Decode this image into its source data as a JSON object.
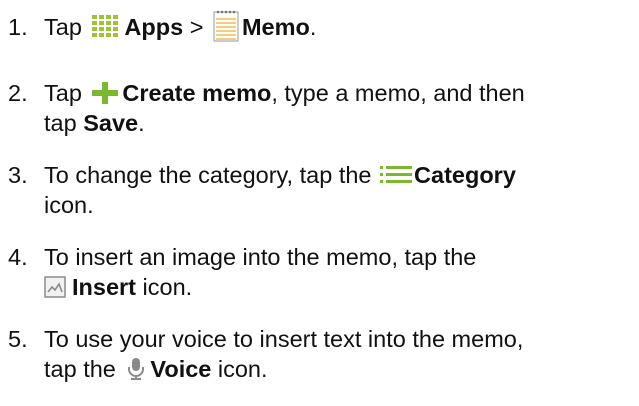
{
  "steps": [
    {
      "number": "1.",
      "tap": "Tap",
      "apps_label": "Apps",
      "separator": ">",
      "memo_label": "Memo",
      "end": ".",
      "icons": [
        "apps-grid-icon",
        "memo-notepad-icon"
      ]
    },
    {
      "number": "2.",
      "tap": "Tap",
      "create_label": "Create memo",
      "mid": ", type a memo, and then",
      "line2_start": "tap",
      "save_label": "Save",
      "end": ".",
      "icons": [
        "plus-icon"
      ]
    },
    {
      "number": "3.",
      "text": "To change the category, tap the",
      "category_label": "Category",
      "line2": "icon.",
      "icons": [
        "category-list-icon"
      ]
    },
    {
      "number": "4.",
      "text": "To insert an image into the memo, tap the",
      "insert_label": "Insert",
      "line2_end": "icon.",
      "icons": [
        "insert-image-icon"
      ]
    },
    {
      "number": "5.",
      "text": "To use your voice to insert text into the memo,",
      "line2_start": "tap the",
      "voice_label": "Voice",
      "line2_end": "icon.",
      "icons": [
        "microphone-icon"
      ]
    }
  ],
  "colors": {
    "text": "#111111",
    "apps_icon": "#9ec23a",
    "plus_icon": "#7cb82f",
    "category_icon": "#7cb82f",
    "memo_icon_lines": "#e6b14a",
    "icon_gray": "#8a8a8a"
  }
}
